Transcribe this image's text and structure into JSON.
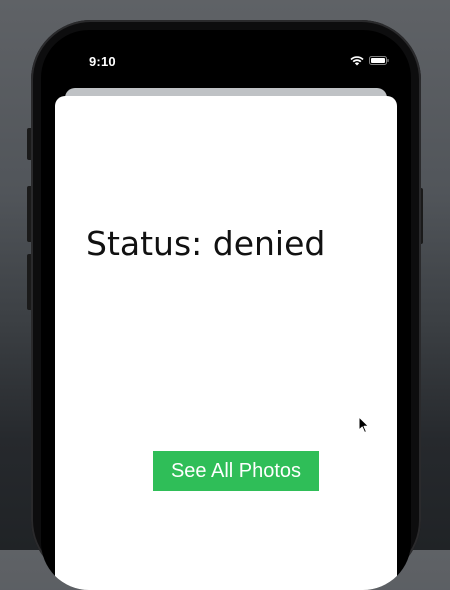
{
  "status_bar": {
    "time": "9:10",
    "icons": [
      "wifi-icon",
      "battery-icon"
    ]
  },
  "content": {
    "status_text": "Status: denied",
    "see_all_photos_label": "See All Photos"
  },
  "colors": {
    "button_green": "#2fbe58",
    "sheet_background": "#ffffff",
    "phone_frame": "#0d0d0e"
  }
}
